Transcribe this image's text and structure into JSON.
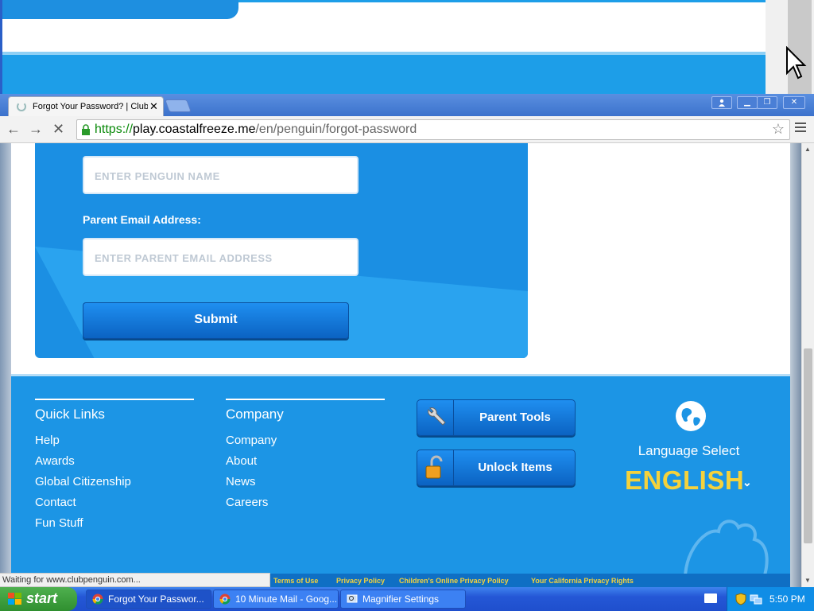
{
  "browser": {
    "tab_title": "Forgot Your Password? | Club Penguin",
    "url_scheme": "https://",
    "url_host": "play.coastalfreeze.me",
    "url_path": "/en/penguin/forgot-password",
    "status_text": "Waiting for www.clubpenguin.com..."
  },
  "form": {
    "penguin_name_placeholder": "ENTER PENGUIN NAME",
    "email_label": "Parent Email Address:",
    "email_placeholder": "ENTER PARENT EMAIL ADDRESS",
    "submit_label": "Submit"
  },
  "footer": {
    "quick_links": {
      "heading": "Quick Links",
      "items": [
        "Help",
        "Awards",
        "Global Citizenship",
        "Contact",
        "Fun Stuff"
      ]
    },
    "company": {
      "heading": "Company",
      "items": [
        "Company",
        "About",
        "News",
        "Careers"
      ]
    },
    "parent_tools_label": "Parent Tools",
    "unlock_items_label": "Unlock Items",
    "language_label": "Language Select",
    "language_value": "ENGLISH",
    "legal_links": [
      "Terms of Use",
      "Privacy Policy",
      "Children's Online Privacy Policy",
      "Your California Privacy Rights"
    ]
  },
  "taskbar": {
    "start_label": "start",
    "tasks": [
      {
        "label": "Forgot Your Passwor...",
        "icon": "chrome-icon"
      },
      {
        "label": "10 Minute Mail - Goog...",
        "icon": "chrome-icon"
      },
      {
        "label": "Magnifier Settings",
        "icon": "magnifier-icon"
      }
    ],
    "clock": "5:50 PM"
  },
  "colors": {
    "brand_blue": "#1b8fe3",
    "footer_blue": "#1c95e5",
    "language_yellow": "#f5d23c",
    "url_green": "#0a8a0a"
  }
}
